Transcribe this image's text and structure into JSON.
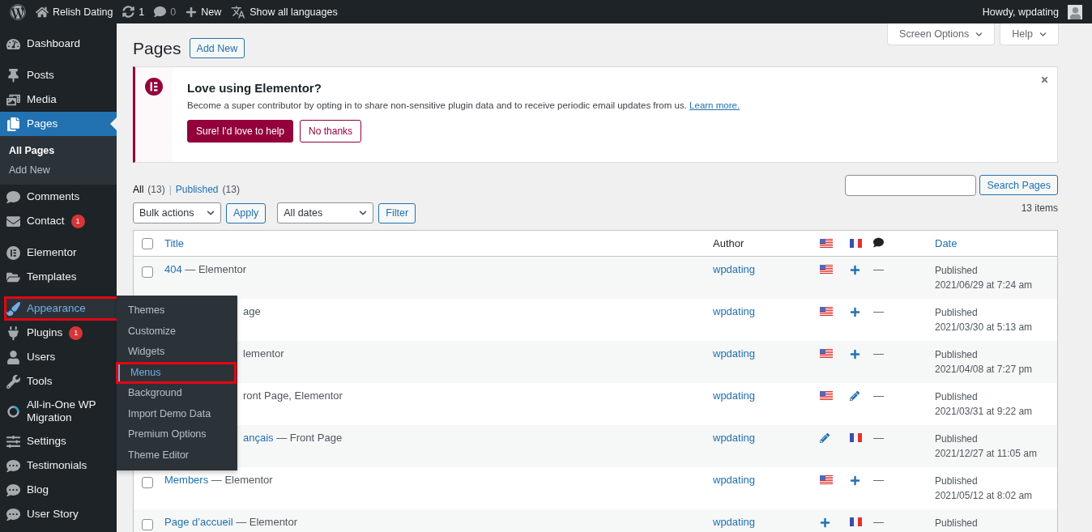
{
  "admin_bar": {
    "site": "Relish Dating",
    "updates": "1",
    "comments": "0",
    "new": "New",
    "languages": "Show all languages",
    "greeting": "Howdy, wpdating"
  },
  "sidebar": {
    "groups": [
      [
        {
          "label": "Dashboard",
          "selected": false,
          "highlighted": false
        }
      ],
      [
        {
          "label": "Posts",
          "selected": false,
          "highlighted": false
        },
        {
          "label": "Media",
          "selected": false,
          "highlighted": false
        },
        {
          "label": "Pages",
          "selected": true,
          "highlighted": false,
          "submenu": [
            {
              "label": "All Pages",
              "selected": true
            },
            {
              "label": "Add New",
              "selected": false
            }
          ]
        },
        {
          "label": "Comments",
          "selected": false,
          "highlighted": false
        },
        {
          "label": "Contact",
          "selected": false,
          "highlighted": false,
          "badge": "1"
        }
      ],
      [
        {
          "label": "Elementor",
          "selected": false,
          "highlighted": false
        },
        {
          "label": "Templates",
          "selected": false,
          "highlighted": false
        }
      ],
      [
        {
          "label": "Appearance",
          "selected": false,
          "highlighted": true,
          "flyout": [
            {
              "label": "Themes",
              "selected": false
            },
            {
              "label": "Customize",
              "selected": false
            },
            {
              "label": "Widgets",
              "selected": false
            },
            {
              "label": "Menus",
              "selected": true
            },
            {
              "label": "Background",
              "selected": false
            },
            {
              "label": "Import Demo Data",
              "selected": false
            },
            {
              "label": "Premium Options",
              "selected": false
            },
            {
              "label": "Theme Editor",
              "selected": false
            }
          ]
        },
        {
          "label": "Plugins",
          "selected": false,
          "highlighted": false,
          "badge": "1"
        },
        {
          "label": "Users",
          "selected": false,
          "highlighted": false
        },
        {
          "label": "Tools",
          "selected": false,
          "highlighted": false
        },
        {
          "label": "All-in-One WP Migration",
          "selected": false,
          "highlighted": false
        },
        {
          "label": "Settings",
          "selected": false,
          "highlighted": false
        },
        {
          "label": "Testimonials",
          "selected": false,
          "highlighted": false
        },
        {
          "label": "Blog",
          "selected": false,
          "highlighted": false
        },
        {
          "label": "User Story",
          "selected": false,
          "highlighted": false
        }
      ]
    ]
  },
  "screen_tabs": [
    "Screen Options",
    "Help"
  ],
  "heading": "Pages",
  "add_new": "Add New",
  "notice": {
    "title": "Love using Elementor?",
    "text": "Become a super contributor by opting in to share non-sensitive plugin data and to receive periodic email updates from us.",
    "link": "Learn more.",
    "primary": "Sure! I'd love to help",
    "secondary": "No thanks"
  },
  "views": [
    {
      "label": "All",
      "count": "(13)",
      "selected": true
    },
    {
      "label": "Published",
      "count": "(13)",
      "selected": false
    }
  ],
  "views_separator": "|",
  "search": {
    "button": "Search Pages"
  },
  "bulk": {
    "select": "Bulk actions",
    "apply": "Apply",
    "dates": "All dates",
    "filter": "Filter"
  },
  "items_count": "13 items",
  "table": {
    "columns": [
      "Title",
      "Author",
      "Date"
    ],
    "select_all_checked": false,
    "rows": [
      {
        "checked": false,
        "link": "404",
        "rest": " — Elementor",
        "hidden": false,
        "author": "wpdating",
        "translations": [
          {
            "kind": "flag_en"
          },
          {
            "kind": "plus"
          }
        ],
        "comments": "—",
        "status": "Published",
        "date": "2021/06/29 at 7:24 am"
      },
      {
        "rest": "age",
        "hidden": true,
        "author": "wpdating",
        "translations": [
          {
            "kind": "flag_en"
          },
          {
            "kind": "plus"
          }
        ],
        "comments": "—",
        "status": "Published",
        "date": "2021/03/30 at 5:13 am"
      },
      {
        "rest": "lementor",
        "hidden": true,
        "author": "wpdating",
        "translations": [
          {
            "kind": "flag_en"
          },
          {
            "kind": "plus"
          }
        ],
        "comments": "—",
        "status": "Published",
        "date": "2021/04/08 at 7:27 pm"
      },
      {
        "rest": "ront Page, Elementor",
        "hidden": true,
        "author": "wpdating",
        "translations": [
          {
            "kind": "flag_en"
          },
          {
            "kind": "pencil"
          }
        ],
        "comments": "—",
        "status": "Published",
        "date": "2021/03/31 at 9:22 am"
      },
      {
        "link_fragment": "ançais",
        "rest": " — Front Page",
        "hidden": true,
        "author": "wpdating",
        "translations": [
          {
            "kind": "pencil"
          },
          {
            "kind": "flag_fr"
          }
        ],
        "comments": "—",
        "status": "Published",
        "date": "2021/12/27 at 11:05 am"
      },
      {
        "checked": false,
        "link": "Members",
        "rest": " — Elementor",
        "hidden": false,
        "author": "wpdating",
        "translations": [
          {
            "kind": "flag_en"
          },
          {
            "kind": "plus"
          }
        ],
        "comments": "—",
        "status": "Published",
        "date": "2021/05/12 at 8:02 am"
      },
      {
        "checked": false,
        "link": "Page d’accueil",
        "rest": " — Elementor",
        "hidden": false,
        "author": "wpdating",
        "translations": [
          {
            "kind": "plus"
          },
          {
            "kind": "flag_fr"
          }
        ],
        "comments": "—",
        "status": "Published"
      }
    ]
  }
}
